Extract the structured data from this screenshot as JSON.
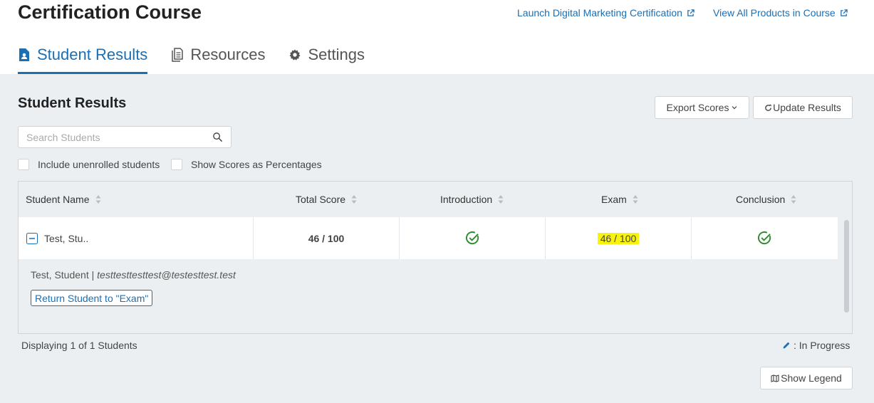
{
  "header": {
    "title": "Certification Course",
    "links": {
      "launch": "Launch Digital Marketing Certification",
      "view_products": "View All Products in Course"
    },
    "tabs": [
      {
        "label": "Student Results",
        "icon": "file-person-icon"
      },
      {
        "label": "Resources",
        "icon": "document-icon"
      },
      {
        "label": "Settings",
        "icon": "gear-icon"
      }
    ]
  },
  "section": {
    "title": "Student Results",
    "export_label": "Export Scores",
    "update_label": "Update Results",
    "search_placeholder": "Search Students",
    "include_unenrolled": "Include unenrolled students",
    "show_percentages": "Show Scores as Percentages"
  },
  "table": {
    "columns": [
      "Student Name",
      "Total Score",
      "Introduction",
      "Exam",
      "Conclusion"
    ],
    "rows": [
      {
        "name": "Test, Stu..",
        "total_score": "46 / 100",
        "introduction": "complete",
        "exam": "46 / 100",
        "conclusion": "complete"
      }
    ],
    "detail": {
      "name": "Test, Student |",
      "email": "testtesttesttest@testesttest.test",
      "return_label": "Return Student to \"Exam\""
    }
  },
  "footer": {
    "displaying": "Displaying 1 of 1 Students",
    "legend_in_progress": ": In Progress",
    "show_legend": "Show Legend"
  },
  "colors": {
    "accent": "#1a6fb5",
    "check_green": "#2e8b2e",
    "highlight": "#f8f20c",
    "panel_bg": "#eceff2"
  }
}
